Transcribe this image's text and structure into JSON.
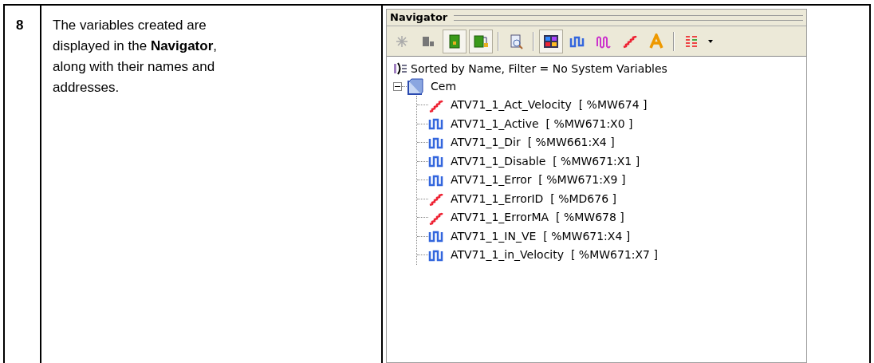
{
  "step": {
    "number": "8",
    "description": "The variables created are displayed in the **Navigator**, along with their names and addresses."
  },
  "navigator": {
    "title": "Navigator",
    "toolbar": [
      {
        "kind": "asterisk",
        "pressed": false
      },
      {
        "kind": "plug",
        "pressed": false
      },
      {
        "kind": "box",
        "pressed": true
      },
      {
        "kind": "linked-box",
        "pressed": true
      },
      {
        "kind": "sep"
      },
      {
        "kind": "doc-search",
        "pressed": false
      },
      {
        "kind": "sep"
      },
      {
        "kind": "grid",
        "pressed": true
      },
      {
        "kind": "pulse",
        "pressed": false
      },
      {
        "kind": "wave",
        "pressed": false
      },
      {
        "kind": "ramp",
        "pressed": false
      },
      {
        "kind": "letter",
        "pressed": false
      },
      {
        "kind": "sep"
      },
      {
        "kind": "bars",
        "pressed": false
      },
      {
        "kind": "dropdown"
      }
    ],
    "sort_text": "Sorted by Name, Filter = No System Variables",
    "tree": [
      {
        "label": "Cem",
        "kind": "folder",
        "expanded": true,
        "children": [
          {
            "label": "ATV71_1_Act_Velocity  [ %MW674 ]",
            "kind": "analog"
          },
          {
            "label": "ATV71_1_Active  [ %MW671:X0 ]",
            "kind": "bool"
          },
          {
            "label": "ATV71_1_Dir  [ %MW661:X4 ]",
            "kind": "bool"
          },
          {
            "label": "ATV71_1_Disable  [ %MW671:X1 ]",
            "kind": "bool"
          },
          {
            "label": "ATV71_1_Error  [ %MW671:X9 ]",
            "kind": "bool"
          },
          {
            "label": "ATV71_1_ErrorID  [ %MD676 ]",
            "kind": "analog"
          },
          {
            "label": "ATV71_1_ErrorMA  [ %MW678 ]",
            "kind": "analog"
          },
          {
            "label": "ATV71_1_IN_VE  [ %MW671:X4 ]",
            "kind": "bool"
          },
          {
            "label": "ATV71_1_in_Velocity  [ %MW671:X7 ]",
            "kind": "bool"
          }
        ]
      }
    ]
  }
}
